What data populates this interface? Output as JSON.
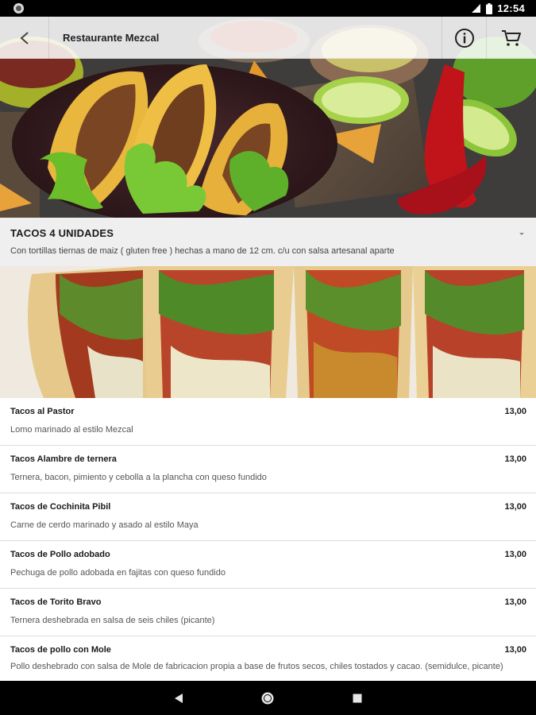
{
  "status_bar": {
    "time": "12:54"
  },
  "app_bar": {
    "title": "Restaurante Mezcal"
  },
  "category": {
    "name": "TACOS 4 UNIDADES",
    "description": "Con tortillas tiernas de maiz ( gluten free ) hechas a mano de 12 cm. c/u con salsa artesanal aparte"
  },
  "items": [
    {
      "name": "Tacos al Pastor",
      "price": "13,00",
      "description": "Lomo marinado al estilo Mezcal"
    },
    {
      "name": "Tacos Alambre de ternera",
      "price": "13,00",
      "description": "Ternera, bacon, pimiento y cebolla a la plancha con queso fundido"
    },
    {
      "name": "Tacos de Cochinita Pibil",
      "price": "13,00",
      "description": "Carne de cerdo marinado y asado al estilo Maya"
    },
    {
      "name": "Tacos de Pollo adobado",
      "price": "13,00",
      "description": "Pechuga de pollo adobada en fajitas con queso fundido"
    },
    {
      "name": "Tacos de Torito Bravo",
      "price": "13,00",
      "description": "Ternera deshebrada en salsa de seis chiles (picante)"
    },
    {
      "name": "Tacos de pollo con Mole",
      "price": "13,00",
      "description": "Pollo deshebrado con salsa de Mole de fabricacion propia a base de frutos secos, chiles tostados y cacao. (semidulce, picante)"
    }
  ],
  "icons": {
    "back": "arrow-back-icon",
    "info": "info-icon",
    "cart": "cart-icon",
    "expand": "chevron-down-icon"
  }
}
